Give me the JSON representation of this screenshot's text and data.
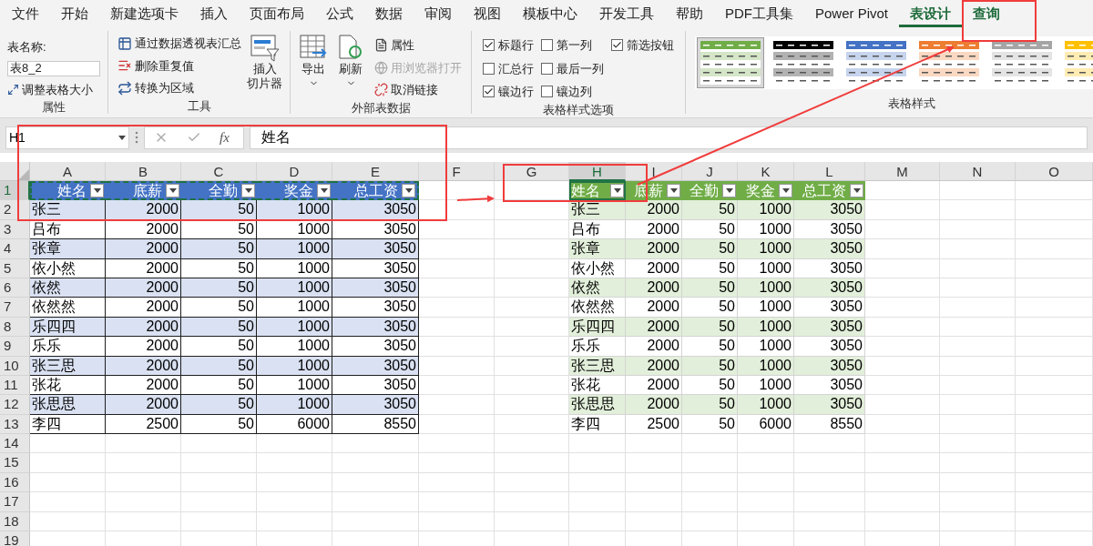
{
  "menu_tabs": [
    {
      "label": "文件",
      "selected": false,
      "contextual": false
    },
    {
      "label": "开始",
      "selected": false,
      "contextual": false
    },
    {
      "label": "新建选项卡",
      "selected": false,
      "contextual": false
    },
    {
      "label": "插入",
      "selected": false,
      "contextual": false
    },
    {
      "label": "页面布局",
      "selected": false,
      "contextual": false
    },
    {
      "label": "公式",
      "selected": false,
      "contextual": false
    },
    {
      "label": "数据",
      "selected": false,
      "contextual": false
    },
    {
      "label": "审阅",
      "selected": false,
      "contextual": false
    },
    {
      "label": "视图",
      "selected": false,
      "contextual": false
    },
    {
      "label": "模板中心",
      "selected": false,
      "contextual": false
    },
    {
      "label": "开发工具",
      "selected": false,
      "contextual": false
    },
    {
      "label": "帮助",
      "selected": false,
      "contextual": false
    },
    {
      "label": "PDF工具集",
      "selected": false,
      "contextual": false
    },
    {
      "label": "Power Pivot",
      "selected": false,
      "contextual": false
    },
    {
      "label": "表设计",
      "selected": true,
      "contextual": true
    },
    {
      "label": "查询",
      "selected": false,
      "contextual": true
    }
  ],
  "ribbon": {
    "properties": {
      "name_label": "表名称:",
      "table_name": "表8_2",
      "resize_button": "调整表格大小",
      "group_label": "属性"
    },
    "tools": {
      "buttons": [
        "通过数据透视表汇总",
        "删除重复值",
        "转换为区域"
      ],
      "slicer_button": [
        "插入",
        "切片器"
      ],
      "group_label": "工具"
    },
    "external": {
      "export_button": "导出",
      "refresh_button": "刷新",
      "small_buttons": [
        {
          "label": "属性",
          "disabled": false
        },
        {
          "label": "用浏览器打开",
          "disabled": true
        },
        {
          "label": "取消链接",
          "disabled": false
        }
      ],
      "group_label": "外部表数据"
    },
    "style_options": {
      "columns": [
        [
          {
            "label": "标题行",
            "checked": true
          },
          {
            "label": "汇总行",
            "checked": false
          },
          {
            "label": "镶边行",
            "checked": true
          }
        ],
        [
          {
            "label": "第一列",
            "checked": false
          },
          {
            "label": "最后一列",
            "checked": false
          },
          {
            "label": "镶边列",
            "checked": false
          }
        ],
        [
          {
            "label": "筛选按钮",
            "checked": true
          }
        ]
      ],
      "group_label": "表格样式选项"
    },
    "styles": {
      "thumbnails": [
        {
          "color": "#70ad47",
          "selected": true
        },
        {
          "color": "#000000",
          "selected": false
        },
        {
          "color": "#4472c4",
          "selected": false
        },
        {
          "color": "#ed7d31",
          "selected": false
        },
        {
          "color": "#a5a5a5",
          "selected": false
        },
        {
          "color": "#ffc000",
          "selected": false
        }
      ],
      "group_label": "表格样式"
    }
  },
  "formula_bar": {
    "name_box": "H1",
    "function_label": "fx",
    "formula": "姓名"
  },
  "sheet": {
    "columns": [
      {
        "label": "A",
        "selected": false
      },
      {
        "label": "B",
        "selected": false
      },
      {
        "label": "C",
        "selected": false
      },
      {
        "label": "D",
        "selected": false
      },
      {
        "label": "E",
        "selected": false
      },
      {
        "label": "F",
        "selected": false
      },
      {
        "label": "G",
        "selected": false
      },
      {
        "label": "H",
        "selected": true
      },
      {
        "label": "I",
        "selected": false
      },
      {
        "label": "J",
        "selected": false
      },
      {
        "label": "K",
        "selected": false
      },
      {
        "label": "L",
        "selected": false
      },
      {
        "label": "M",
        "selected": false
      },
      {
        "label": "N",
        "selected": false
      },
      {
        "label": "O",
        "selected": false
      }
    ],
    "rows": [
      {
        "label": "1",
        "selected": true
      },
      {
        "label": "2",
        "selected": false
      },
      {
        "label": "3",
        "selected": false
      },
      {
        "label": "4",
        "selected": false
      },
      {
        "label": "5",
        "selected": false
      },
      {
        "label": "6",
        "selected": false
      },
      {
        "label": "7",
        "selected": false
      },
      {
        "label": "8",
        "selected": false
      },
      {
        "label": "9",
        "selected": false
      },
      {
        "label": "10",
        "selected": false
      },
      {
        "label": "11",
        "selected": false
      },
      {
        "label": "12",
        "selected": false
      },
      {
        "label": "13",
        "selected": false
      },
      {
        "label": "14",
        "selected": false
      },
      {
        "label": "15",
        "selected": false
      },
      {
        "label": "16",
        "selected": false
      },
      {
        "label": "17",
        "selected": false
      },
      {
        "label": "18",
        "selected": false
      },
      {
        "label": "19",
        "selected": false
      }
    ],
    "tables": [
      {
        "kind": "blue",
        "copy_marquee": true,
        "headers": [
          "姓名",
          "底薪",
          "全勤",
          "奖金",
          "总工资"
        ],
        "rows": [
          [
            "张三",
            "2000",
            "50",
            "1000",
            "3050"
          ],
          [
            "吕布",
            "2000",
            "50",
            "1000",
            "3050"
          ],
          [
            "张章",
            "2000",
            "50",
            "1000",
            "3050"
          ],
          [
            "依小然",
            "2000",
            "50",
            "1000",
            "3050"
          ],
          [
            "依然",
            "2000",
            "50",
            "1000",
            "3050"
          ],
          [
            "依然然",
            "2000",
            "50",
            "1000",
            "3050"
          ],
          [
            "乐四四",
            "2000",
            "50",
            "1000",
            "3050"
          ],
          [
            "乐乐",
            "2000",
            "50",
            "1000",
            "3050"
          ],
          [
            "张三思",
            "2000",
            "50",
            "1000",
            "3050"
          ],
          [
            "张花",
            "2000",
            "50",
            "1000",
            "3050"
          ],
          [
            "张思思",
            "2000",
            "50",
            "1000",
            "3050"
          ],
          [
            "李四",
            "2500",
            "50",
            "6000",
            "8550"
          ]
        ]
      },
      {
        "kind": "green",
        "copy_marquee": false,
        "headers": [
          "姓名",
          "底薪",
          "全勤",
          "奖金",
          "总工资"
        ],
        "rows": [
          [
            "张三",
            "2000",
            "50",
            "1000",
            "3050"
          ],
          [
            "吕布",
            "2000",
            "50",
            "1000",
            "3050"
          ],
          [
            "张章",
            "2000",
            "50",
            "1000",
            "3050"
          ],
          [
            "依小然",
            "2000",
            "50",
            "1000",
            "3050"
          ],
          [
            "依然",
            "2000",
            "50",
            "1000",
            "3050"
          ],
          [
            "依然然",
            "2000",
            "50",
            "1000",
            "3050"
          ],
          [
            "乐四四",
            "2000",
            "50",
            "1000",
            "3050"
          ],
          [
            "乐乐",
            "2000",
            "50",
            "1000",
            "3050"
          ],
          [
            "张三思",
            "2000",
            "50",
            "1000",
            "3050"
          ],
          [
            "张花",
            "2000",
            "50",
            "1000",
            "3050"
          ],
          [
            "张思思",
            "2000",
            "50",
            "1000",
            "3050"
          ],
          [
            "李四",
            "2500",
            "50",
            "6000",
            "8550"
          ]
        ]
      }
    ]
  }
}
